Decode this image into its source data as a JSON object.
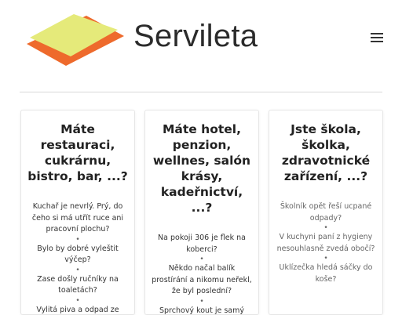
{
  "site": {
    "brand": "Servileta",
    "logo_icon": "napkin-logo-icon",
    "menu_icon": "hamburger-menu-icon",
    "colors": {
      "logo_yellow": "#e5ea7a",
      "logo_orange": "#ee6a2c"
    }
  },
  "cards": [
    {
      "title": "Máte restauraci, cukrárnu, bistro, bar, ...?",
      "items": [
        "Kuchař je nevrlý. Prý, do čeho si má utřít ruce ani pracovní plochu?",
        "Bylo by dobré vyleštit výčep?",
        "Zase došly ručníky na toaletách?",
        "Vylitá piva a odpad ze stolů"
      ]
    },
    {
      "title": "Máte hotel, penzion, wellnes, salón krásy, kadeřnictví, ...?",
      "items": [
        "Na pokoji 306 je flek na koberci?",
        "Někdo načal balík prostírání a nikomu neřekl, že byl poslední?",
        "Sprchový kout je samý"
      ]
    },
    {
      "title": "Jste škola, školka, zdravotnické zařízení, ...?",
      "items": [
        "Školník opět řeší ucpané odpady?",
        "V kuchyni paní z hygieny nesouhlasně zvedá obočí?",
        "Uklízečka hledá sáčky do koše?"
      ]
    }
  ],
  "separator": "•"
}
